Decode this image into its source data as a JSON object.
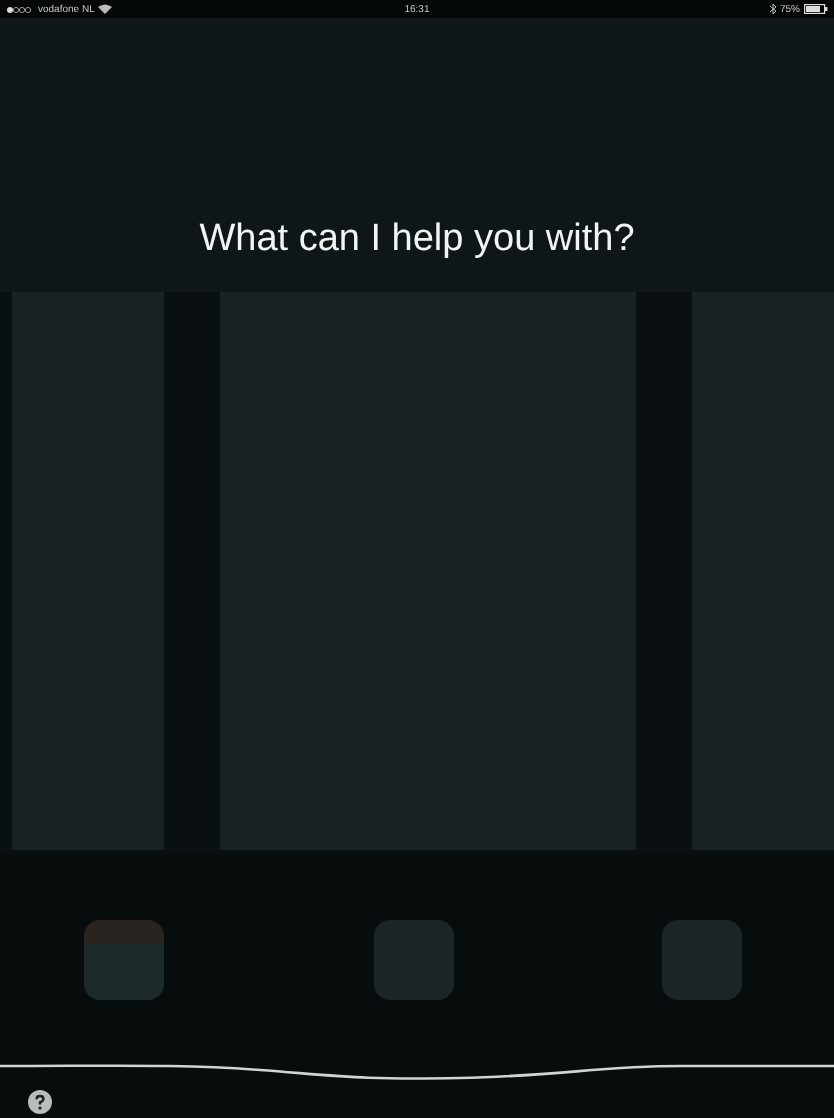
{
  "status_bar": {
    "carrier": "vodafone NL",
    "time": "16:31",
    "battery": "75%"
  },
  "prompt": "What can I help you with?"
}
